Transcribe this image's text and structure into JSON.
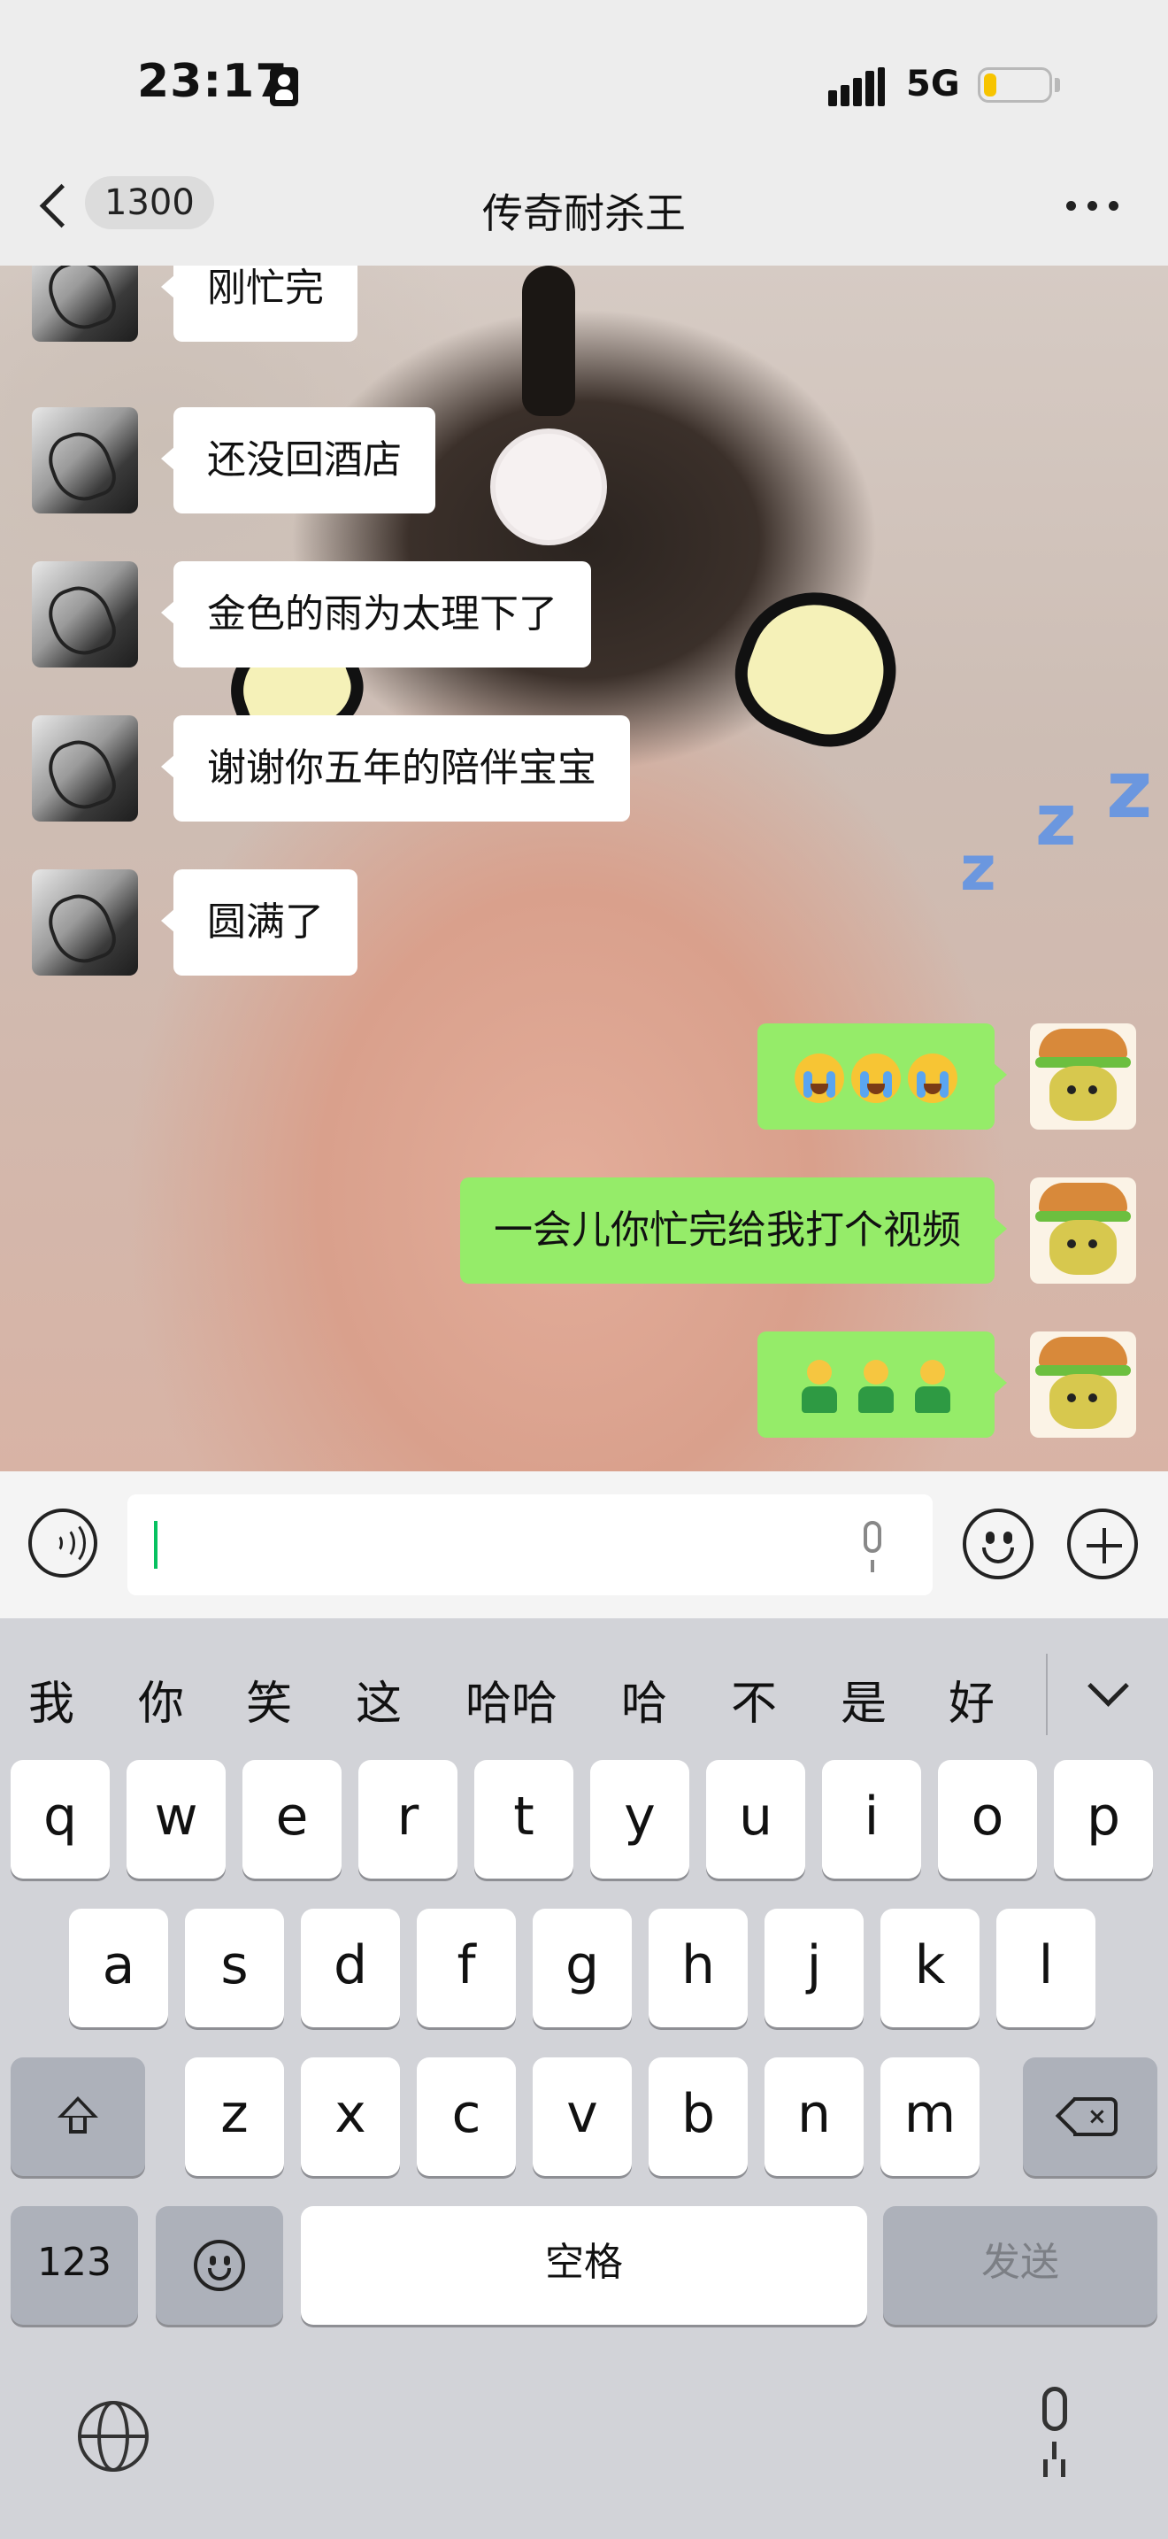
{
  "status_bar": {
    "time": "23:17",
    "network": "5G",
    "battery_level": 0.2,
    "battery_color": "#f7c400"
  },
  "nav": {
    "unread_count": "1300",
    "title": "传奇耐杀王"
  },
  "chat": {
    "incoming": [
      "刚忙完",
      "还没回酒店",
      "金色的雨为太理下了",
      "谢谢你五年的陪伴宝宝",
      "圆满了"
    ],
    "outgoing": [
      {
        "kind": "emoji",
        "emoji": "loudly-crying-face",
        "count": 3
      },
      {
        "kind": "text",
        "text": "一会儿你忙完给我打个视频"
      },
      {
        "kind": "emoji",
        "emoji": "standing-person",
        "count": 3
      }
    ],
    "outgoing_bubble_color": "#95ec69",
    "incoming_bubble_color": "#ffffff"
  },
  "input": {
    "caret_color": "#07c160"
  },
  "keyboard": {
    "candidates": [
      "我",
      "你",
      "笑",
      "这",
      "哈哈",
      "哈",
      "不",
      "是",
      "好"
    ],
    "row1": [
      "q",
      "w",
      "e",
      "r",
      "t",
      "y",
      "u",
      "i",
      "o",
      "p"
    ],
    "row2": [
      "a",
      "s",
      "d",
      "f",
      "g",
      "h",
      "j",
      "k",
      "l"
    ],
    "row3": [
      "z",
      "x",
      "c",
      "v",
      "b",
      "n",
      "m"
    ],
    "numbers_key": "123",
    "space_key": "空格",
    "send_key": "发送"
  }
}
